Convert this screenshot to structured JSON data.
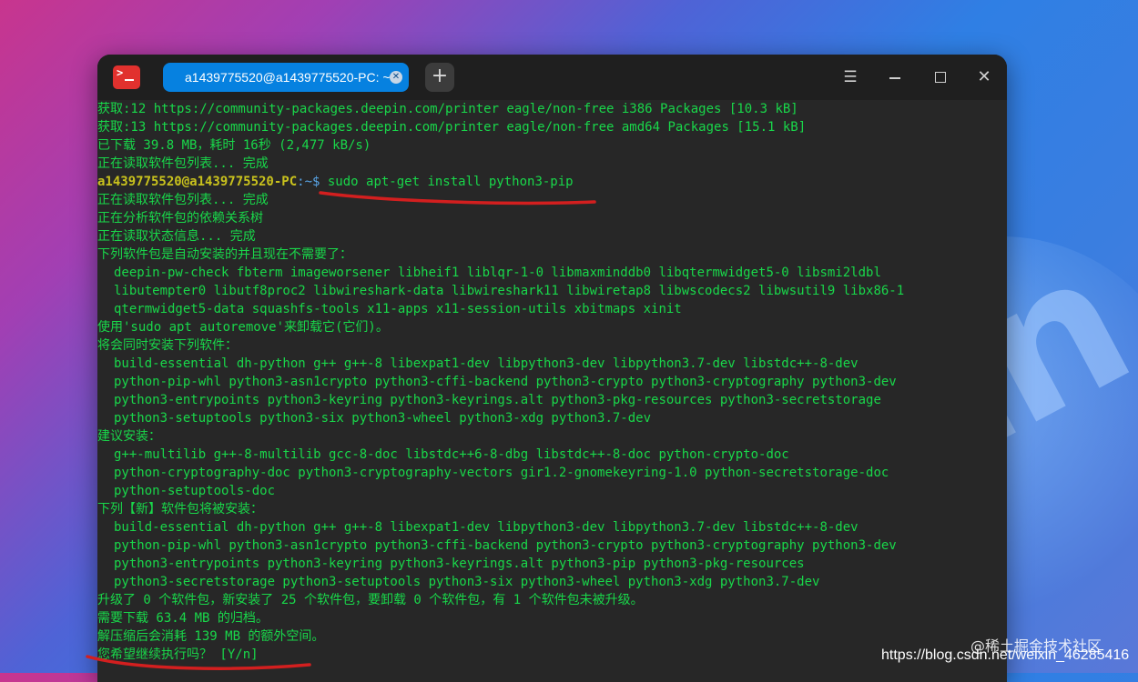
{
  "window": {
    "tab_title": "a1439775520@a1439775520-PC: ~",
    "tab_close_icon": "close-icon",
    "new_tab_label": "+",
    "menu_label": "☰",
    "close_label": "✕",
    "colors": {
      "tab_active": "#0681e0",
      "terminal_bg": "#272727",
      "terminal_text": "#19d74a",
      "prompt_user": "#c9c21d",
      "prompt_path": "#59a6e8"
    }
  },
  "terminal": {
    "lines": [
      {
        "text": "获取:12 https://community-packages.deepin.com/printer eagle/non-free i386 Packages [10.3 kB]"
      },
      {
        "text": "获取:13 https://community-packages.deepin.com/printer eagle/non-free amd64 Packages [15.1 kB]"
      },
      {
        "text": "已下载 39.8 MB，耗时 16秒 (2,477 kB/s)"
      },
      {
        "text": "正在读取软件包列表... 完成"
      },
      {
        "prompt_user": "a1439775520@a1439775520-PC",
        "prompt_path": ":~$ ",
        "command": "sudo apt-get install python3-pip"
      },
      {
        "text": "正在读取软件包列表... 完成"
      },
      {
        "text": "正在分析软件包的依赖关系树"
      },
      {
        "text": "正在读取状态信息... 完成"
      },
      {
        "text": "下列软件包是自动安装的并且现在不需要了："
      },
      {
        "text": "deepin-pw-check fbterm imageworsener libheif1 liblqr-1-0 libmaxminddb0 libqtermwidget5-0 libsmi2ldbl",
        "indent": true
      },
      {
        "text": "libutempter0 libutf8proc2 libwireshark-data libwireshark11 libwiretap8 libwscodecs2 libwsutil9 libx86-1",
        "indent": true
      },
      {
        "text": "qtermwidget5-data squashfs-tools x11-apps x11-session-utils xbitmaps xinit",
        "indent": true
      },
      {
        "text": "使用'sudo apt autoremove'来卸载它(它们)。"
      },
      {
        "text": "将会同时安装下列软件："
      },
      {
        "text": "build-essential dh-python g++ g++-8 libexpat1-dev libpython3-dev libpython3.7-dev libstdc++-8-dev",
        "indent": true
      },
      {
        "text": "python-pip-whl python3-asn1crypto python3-cffi-backend python3-crypto python3-cryptography python3-dev",
        "indent": true
      },
      {
        "text": "python3-entrypoints python3-keyring python3-keyrings.alt python3-pkg-resources python3-secretstorage",
        "indent": true
      },
      {
        "text": "python3-setuptools python3-six python3-wheel python3-xdg python3.7-dev",
        "indent": true
      },
      {
        "text": "建议安装："
      },
      {
        "text": "g++-multilib g++-8-multilib gcc-8-doc libstdc++6-8-dbg libstdc++-8-doc python-crypto-doc",
        "indent": true
      },
      {
        "text": "python-cryptography-doc python3-cryptography-vectors gir1.2-gnomekeyring-1.0 python-secretstorage-doc",
        "indent": true
      },
      {
        "text": "python-setuptools-doc",
        "indent": true
      },
      {
        "text": "下列【新】软件包将被安装："
      },
      {
        "text": "build-essential dh-python g++ g++-8 libexpat1-dev libpython3-dev libpython3.7-dev libstdc++-8-dev",
        "indent": true
      },
      {
        "text": "python-pip-whl python3-asn1crypto python3-cffi-backend python3-crypto python3-cryptography python3-dev",
        "indent": true
      },
      {
        "text": "python3-entrypoints python3-keyring python3-keyrings.alt python3-pip python3-pkg-resources",
        "indent": true
      },
      {
        "text": "python3-secretstorage python3-setuptools python3-six python3-wheel python3-xdg python3.7-dev",
        "indent": true
      },
      {
        "text": "升级了 0 个软件包，新安装了 25 个软件包，要卸载 0 个软件包，有 1 个软件包未被升级。"
      },
      {
        "text": "需要下载 63.4 MB 的归档。"
      },
      {
        "text": "解压缩后会消耗 139 MB 的额外空间。"
      },
      {
        "text": "您希望继续执行吗？ [Y/n]"
      }
    ]
  },
  "watermark": {
    "line1": "@稀土掘金技术社区",
    "line2": "https://blog.csdn.net/weixin_46285416"
  }
}
